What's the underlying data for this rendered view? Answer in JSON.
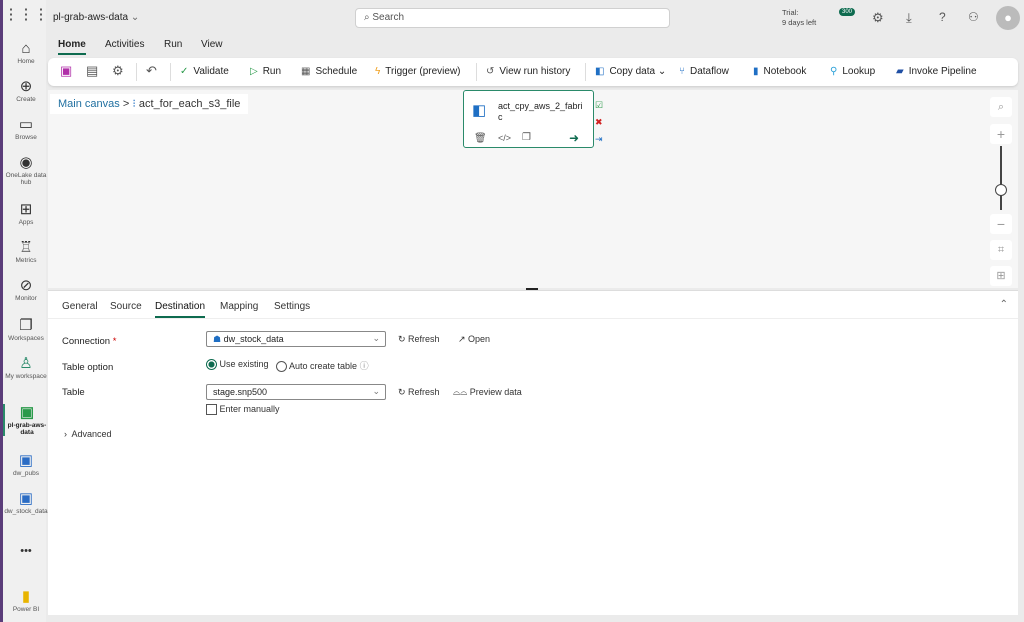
{
  "app": {
    "title": "pl-grab-aws-data",
    "search_placeholder": "Search",
    "trial_line1": "Trial:",
    "trial_line2": "9 days left",
    "notif_count": "300"
  },
  "rail": [
    {
      "label": "Home",
      "icon": "⌂"
    },
    {
      "label": "Create",
      "icon": "⊕"
    },
    {
      "label": "Browse",
      "icon": "▭"
    },
    {
      "label": "OneLake data hub",
      "icon": "◉"
    },
    {
      "label": "Apps",
      "icon": "⊞"
    },
    {
      "label": "Metrics",
      "icon": "♖"
    },
    {
      "label": "Monitor",
      "icon": "⊘"
    },
    {
      "label": "Workspaces",
      "icon": "❐"
    },
    {
      "label": "My workspace",
      "icon": "♙"
    },
    {
      "label": "pl-grab-aws-data",
      "icon": "▣"
    },
    {
      "label": "dw_pubs",
      "icon": "▣"
    },
    {
      "label": "dw_stock_data",
      "icon": "▣"
    },
    {
      "label": "•••",
      "icon": ""
    },
    {
      "label": "Power BI",
      "icon": "▮"
    }
  ],
  "ribbon": {
    "tabs": [
      "Home",
      "Activities",
      "Run",
      "View"
    ],
    "tools": {
      "validate": "Validate",
      "run": "Run",
      "schedule": "Schedule",
      "trigger": "Trigger (preview)",
      "history": "View run history",
      "copy": "Copy data",
      "dataflow": "Dataflow",
      "notebook": "Notebook",
      "lookup": "Lookup",
      "invoke": "Invoke Pipeline"
    }
  },
  "breadcrumb": {
    "root": "Main canvas",
    "sep": ">",
    "current": "act_for_each_s3_file"
  },
  "node": {
    "name": "act_cpy_aws_2_fabri",
    "name2": "c"
  },
  "panel": {
    "tabs": [
      "General",
      "Source",
      "Destination",
      "Mapping",
      "Settings"
    ],
    "connection_label": "Connection",
    "required": "*",
    "connection_value": "dw_stock_data",
    "refresh": "Refresh",
    "open": "Open",
    "table_option_label": "Table option",
    "use_existing": "Use existing",
    "auto_create": "Auto create table",
    "table_label": "Table",
    "table_value": "stage.snp500",
    "preview": "Preview data",
    "enter_manually": "Enter manually",
    "advanced": "Advanced"
  }
}
